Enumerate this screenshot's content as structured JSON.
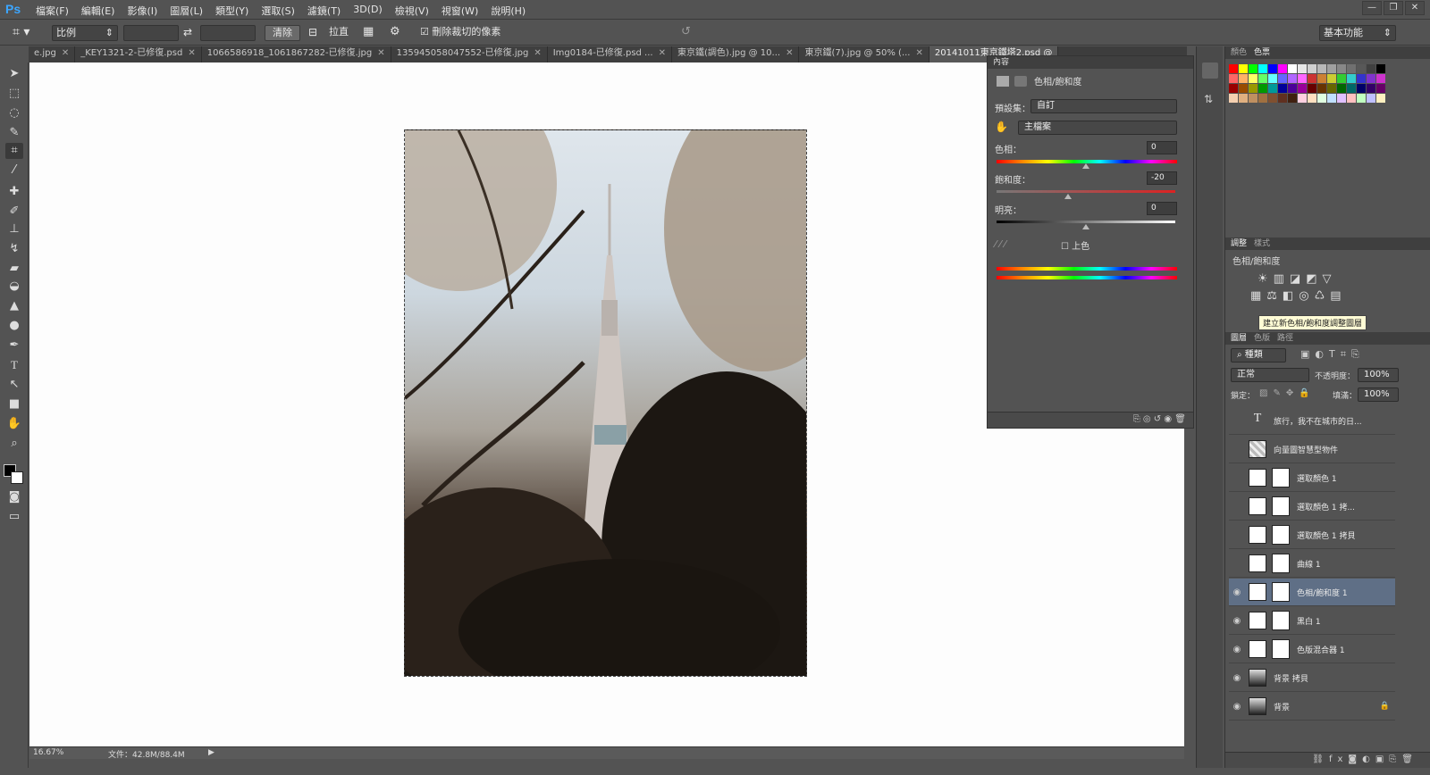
{
  "app": {
    "logo": "Ps"
  },
  "menu": [
    "檔案(F)",
    "編輯(E)",
    "影像(I)",
    "圖層(L)",
    "類型(Y)",
    "選取(S)",
    "濾鏡(T)",
    "3D(D)",
    "檢視(V)",
    "視窗(W)",
    "說明(H)"
  ],
  "window_buttons": [
    "—",
    "❐",
    "✕"
  ],
  "options": {
    "ratio": "比例",
    "clear": "清除",
    "straighten": "拉直",
    "delete_cropped": "刪除裁切的像素",
    "workspace": "基本功能"
  },
  "tabs": [
    {
      "label": "e.jpg",
      "active": false
    },
    {
      "label": "_KEY1321-2-已修復.psd",
      "active": false
    },
    {
      "label": "1066586918_1061867282-已修復.jpg",
      "active": false
    },
    {
      "label": "135945058047552-已修復.jpg",
      "active": false
    },
    {
      "label": "Img0184-已修復.psd ...",
      "active": false
    },
    {
      "label": "東京鐵(調色).jpg @ 10...",
      "active": false
    },
    {
      "label": "東京鐵(7).jpg @ 50% (...",
      "active": false
    },
    {
      "label": "20141011東京鐵塔2.psd @",
      "active": true
    }
  ],
  "status": {
    "zoom": "16.67%",
    "doc": "文件：42.8M/88.4M"
  },
  "properties": {
    "tab": "內容",
    "title": "色相/飽和度",
    "preset_label": "預設集：",
    "preset_value": "自訂",
    "channel": "主檔案",
    "hue_label": "色相：",
    "hue_value": "0",
    "sat_label": "飽和度：",
    "sat_value": "-20",
    "light_label": "明亮：",
    "light_value": "0",
    "colorize": "上色"
  },
  "color_panel": {
    "tabs": [
      "顏色",
      "色票"
    ]
  },
  "adjust_panel": {
    "tabs": [
      "調整",
      "樣式"
    ],
    "subtitle": "色相/飽和度",
    "tooltip": "建立新色相/飽和度調整圖層"
  },
  "layers_panel": {
    "tabs": [
      "圖層",
      "色版",
      "路徑"
    ],
    "filter": "種類",
    "blend": "正常",
    "opacity_label": "不透明度：",
    "opacity": "100%",
    "lock_label": "鎖定：",
    "fill_label": "填滿：",
    "fill": "100%",
    "layers": [
      {
        "name": "旅行，我不在城市的日...",
        "visible": false,
        "sel": false
      },
      {
        "name": "向量圖智慧型物件",
        "visible": false,
        "sel": false
      },
      {
        "name": "選取顏色 1",
        "visible": false,
        "sel": false
      },
      {
        "name": "選取顏色 1 拷...",
        "visible": false,
        "sel": false
      },
      {
        "name": "選取顏色 1 拷貝",
        "visible": false,
        "sel": false
      },
      {
        "name": "曲線 1",
        "visible": false,
        "sel": false
      },
      {
        "name": "色相/飽和度 1",
        "visible": true,
        "sel": true
      },
      {
        "name": "黑白 1",
        "visible": true,
        "sel": false
      },
      {
        "name": "色版混合器 1",
        "visible": true,
        "sel": false
      },
      {
        "name": "背景 拷貝",
        "visible": true,
        "sel": false
      },
      {
        "name": "背景",
        "visible": true,
        "sel": false
      }
    ]
  }
}
